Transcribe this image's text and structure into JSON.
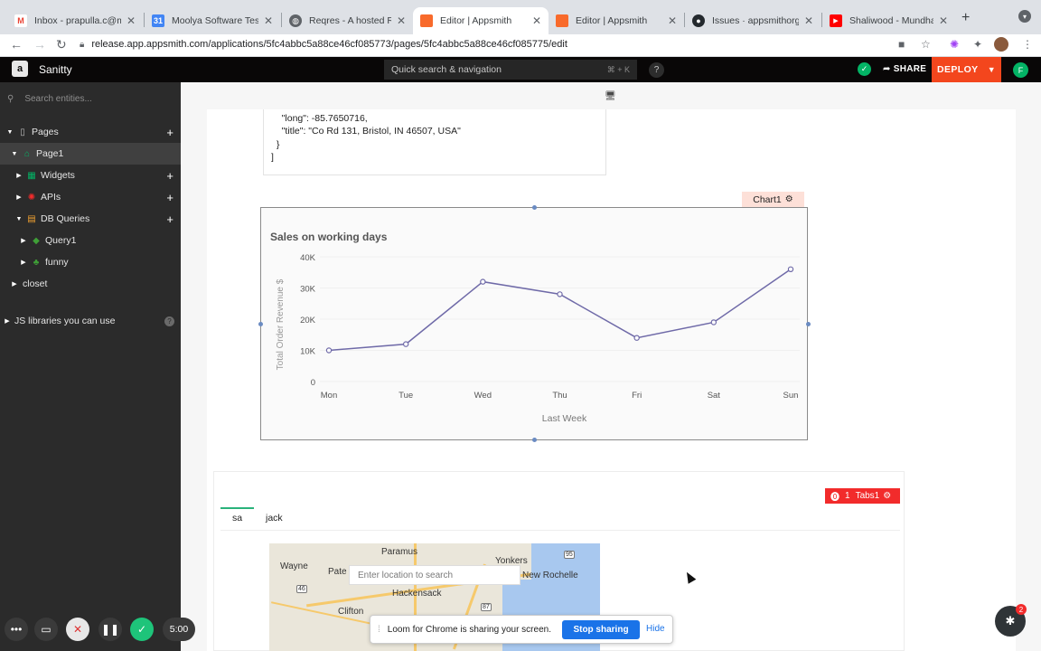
{
  "browser": {
    "tabs": [
      {
        "title": "Inbox - prapulla.c@m",
        "favicon": "gmail-icon",
        "color": "#ea4335",
        "glyph": "M"
      },
      {
        "title": "Moolya Software Testi",
        "favicon": "calendar-icon",
        "color": "#4285f4",
        "glyph": "31"
      },
      {
        "title": "Reqres - A hosted RE",
        "favicon": "globe-icon",
        "color": "#5f6368",
        "glyph": "◍"
      },
      {
        "title": "Editor | Appsmith",
        "favicon": "appsmith-icon",
        "color": "#f86a2b",
        "glyph": ""
      },
      {
        "title": "Editor | Appsmith",
        "favicon": "appsmith-icon",
        "color": "#f86a2b",
        "glyph": ""
      },
      {
        "title": "Issues · appsmithorg/",
        "favicon": "github-icon",
        "color": "#24292e",
        "glyph": "●"
      },
      {
        "title": "Shaliwood - Mundha",
        "favicon": "youtube-icon",
        "color": "#ff0000",
        "glyph": "▶"
      }
    ],
    "url": "release.app.appsmith.com/applications/5fc4abbc5a88ce46cf085773/pages/5fc4abbc5a88ce46cf085775/edit"
  },
  "header": {
    "app_name": "Sanitty",
    "search_placeholder": "Quick search & navigation",
    "search_shortcut": "⌘ + K",
    "help": "?",
    "share_label": "SHARE",
    "deploy_label": "DEPLOY",
    "avatar_initial": "F"
  },
  "sidebar": {
    "search_placeholder": "Search entities...",
    "pages_label": "Pages",
    "page1_label": "Page1",
    "widgets_label": "Widgets",
    "apis_label": "APIs",
    "db_queries_label": "DB Queries",
    "query1_label": "Query1",
    "funny_label": "funny",
    "closet_label": "closet",
    "js_libs_label": "JS libraries you can use"
  },
  "json_text": {
    "line1": "    \"long\": -85.7650716,",
    "line2": "    \"title\": \"Co Rd 131, Bristol, IN 46507, USA\"",
    "line3": "  }",
    "line4": "]"
  },
  "chart_widget": {
    "label": "Chart1"
  },
  "chart_data": {
    "type": "line",
    "title": "Sales on working days",
    "xlabel": "Last Week",
    "ylabel": "Total Order Revenue $",
    "categories": [
      "Mon",
      "Tue",
      "Wed",
      "Thu",
      "Fri",
      "Sat",
      "Sun"
    ],
    "values": [
      10000,
      12000,
      32000,
      28000,
      14000,
      19000,
      36000
    ],
    "ylim": [
      0,
      40000
    ],
    "yticks": [
      "0",
      "10K",
      "20K",
      "30K",
      "40K"
    ],
    "line_color": "#6f6aa8"
  },
  "tabs_widget": {
    "error_count": "1",
    "label": "Tabs1",
    "tabs": [
      "sa",
      "jack"
    ]
  },
  "map": {
    "search_placeholder": "Enter location to search",
    "labels": [
      "Paramus",
      "Yonkers",
      "Wayne",
      "Pate",
      "New Rochelle",
      "Hackensack",
      "Clifton"
    ]
  },
  "loom": {
    "message": "Loom for Chrome is sharing your screen.",
    "stop_label": "Stop sharing",
    "hide_label": "Hide"
  },
  "recorder": {
    "timer": "5:00"
  },
  "debugger": {
    "badge": "2"
  }
}
